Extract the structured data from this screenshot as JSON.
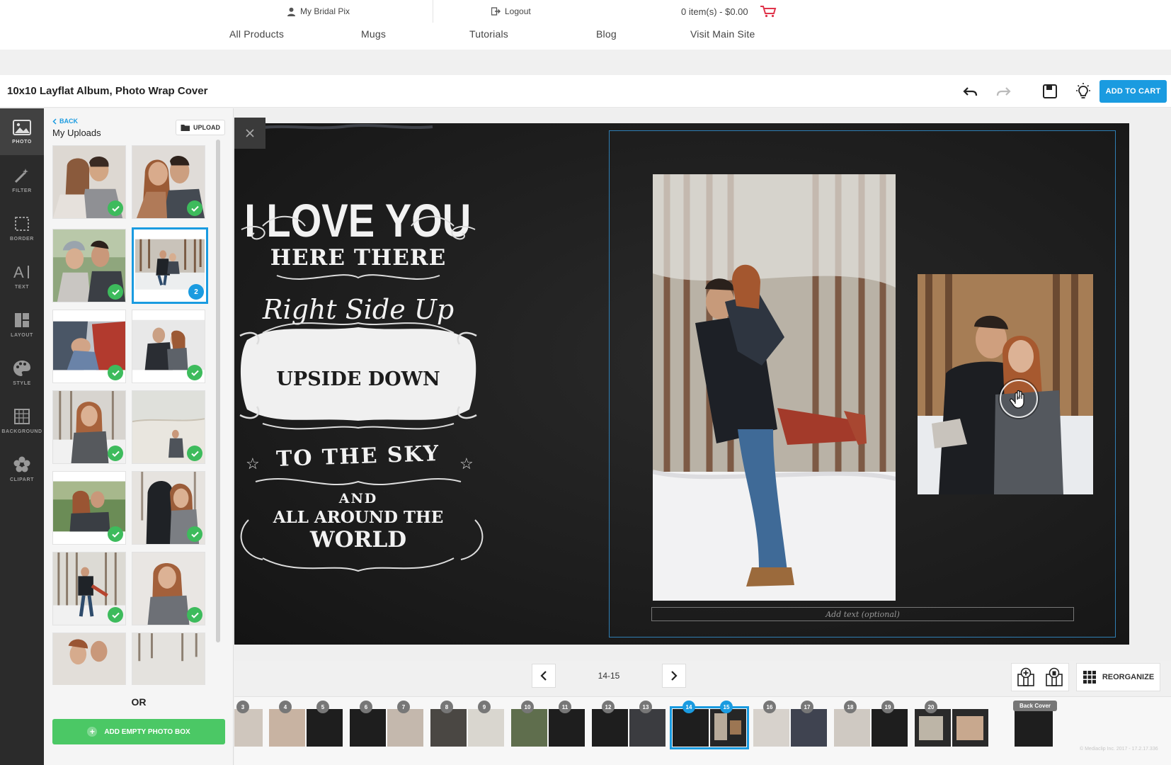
{
  "header": {
    "account_label": "My Bridal Pix",
    "logout_label": "Logout",
    "cart_label": "0 item(s) - $0.00",
    "nav": [
      "All Products",
      "Mugs",
      "Tutorials",
      "Blog",
      "Visit Main Site"
    ]
  },
  "titlebar": {
    "title": "10x10 Layflat Album, Photo Wrap Cover",
    "add_to_cart": "ADD TO CART"
  },
  "tools": [
    {
      "label": "PHOTO",
      "icon": "photo-icon",
      "active": true
    },
    {
      "label": "FILTER",
      "icon": "magic-wand-icon",
      "active": false
    },
    {
      "label": "BORDER",
      "icon": "border-icon",
      "active": false
    },
    {
      "label": "TEXT",
      "icon": "text-icon",
      "active": false
    },
    {
      "label": "LAYOUT",
      "icon": "layout-icon",
      "active": false
    },
    {
      "label": "STYLE",
      "icon": "palette-icon",
      "active": false
    },
    {
      "label": "BACKGROUND",
      "icon": "background-icon",
      "active": false
    },
    {
      "label": "CLIPART",
      "icon": "clipart-icon",
      "active": false
    }
  ],
  "panel": {
    "back_label": "BACK",
    "title": "My Uploads",
    "upload_label": "UPLOAD",
    "selected_count": "2",
    "or_label": "OR",
    "add_empty_label": "ADD EMPTY PHOTO BOX"
  },
  "canvas": {
    "chalk_lines": [
      "I LOVE YOU",
      "HERE THERE",
      "Right Side Up",
      "UPSIDE DOWN",
      "TO THE SKY",
      "AND",
      "ALL AROUND THE",
      "WORLD"
    ],
    "caption_placeholder": "Add text (optional)"
  },
  "pager": {
    "page_label": "14-15",
    "reorganize_label": "REORGANIZE"
  },
  "filmstrip": {
    "spreads": [
      {
        "left": "",
        "right": "3"
      },
      {
        "left": "4",
        "right": "5"
      },
      {
        "left": "6",
        "right": "7"
      },
      {
        "left": "8",
        "right": "9"
      },
      {
        "left": "10",
        "right": "11"
      },
      {
        "left": "12",
        "right": "13"
      },
      {
        "left": "14",
        "right": "15"
      },
      {
        "left": "16",
        "right": "17"
      },
      {
        "left": "18",
        "right": "19"
      },
      {
        "left": "20",
        "right": ""
      }
    ],
    "back_cover_label": "Back Cover"
  },
  "footer": {
    "copyright": "© Mediaclip Inc. 2017 - 17.2.17.336"
  },
  "colors": {
    "accent": "#1a9be0",
    "success": "#3dbb5c",
    "rail": "#2b2b2b",
    "canvas": "#1b1b1b"
  }
}
